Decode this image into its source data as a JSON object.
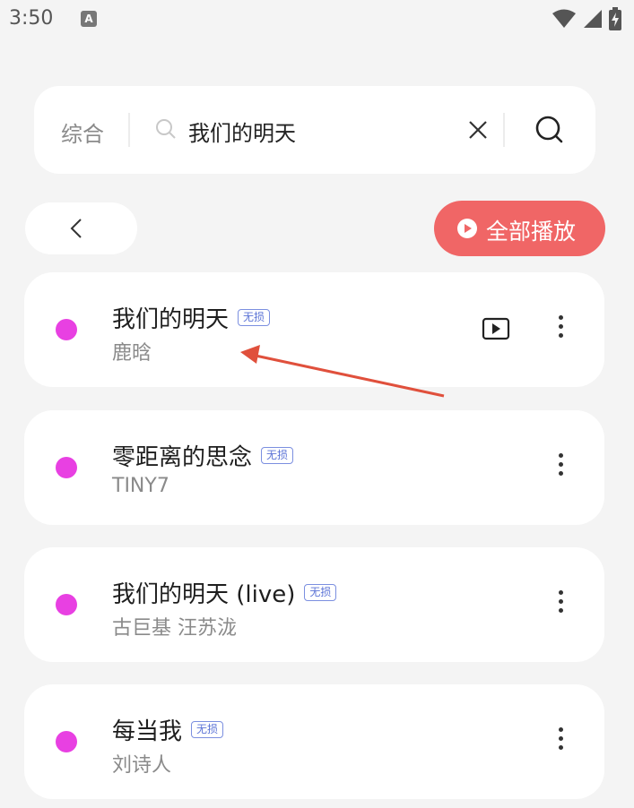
{
  "status_bar": {
    "time": "3:50",
    "notification_letter": "A"
  },
  "search": {
    "type_label": "综合",
    "query": "我们的明天"
  },
  "actions": {
    "play_all_label": "全部播放"
  },
  "songs": [
    {
      "title": "我们的明天",
      "badge": "无损",
      "artist": "鹿晗",
      "has_video": true
    },
    {
      "title": "零距离的思念",
      "badge": "无损",
      "artist": "TINY7",
      "has_video": false
    },
    {
      "title": "我们的明天 (live)",
      "badge": "无损",
      "artist": "古巨基 汪苏泷",
      "has_video": false
    },
    {
      "title": "每当我",
      "badge": "无损",
      "artist": "刘诗人",
      "has_video": false
    }
  ],
  "colors": {
    "accent": "#f06666",
    "dot": "#e840e2",
    "badge": "#5b73d6",
    "annotation_arrow": "#e0503c"
  }
}
